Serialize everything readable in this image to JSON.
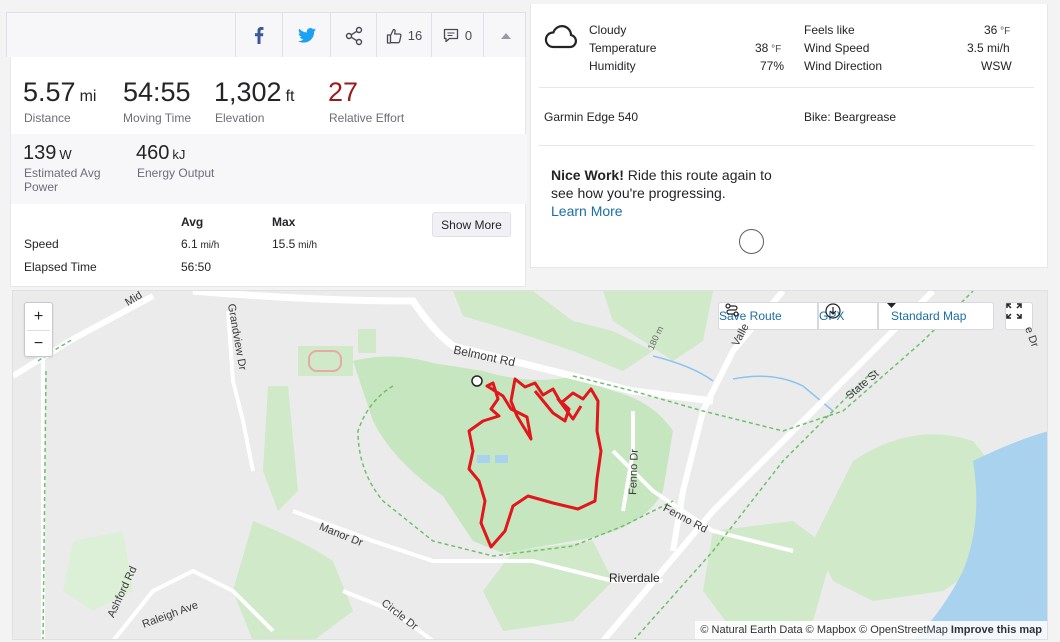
{
  "share_bar": {
    "facebook_icon": "facebook-icon",
    "twitter_icon": "twitter-icon",
    "share_icon": "share-icon",
    "kudos_count": "16",
    "comments_count": "0",
    "collapse_icon": "chevron-up-icon"
  },
  "stats": {
    "distance": {
      "value": "5.57",
      "unit": "mi",
      "label": "Distance"
    },
    "moving_time": {
      "value": "54:55",
      "label": "Moving Time"
    },
    "elevation": {
      "value": "1,302",
      "unit": "ft",
      "label": "Elevation"
    },
    "relative_effort": {
      "value": "27",
      "label": "Relative Effort",
      "color": "#9b1b1b"
    },
    "power": {
      "value": "139",
      "unit": "W",
      "label_line1": "Estimated Avg",
      "label_line2": "Power"
    },
    "energy": {
      "value": "460",
      "unit": "kJ",
      "label": "Energy Output"
    },
    "table": {
      "col_avg": "Avg",
      "col_max": "Max",
      "speed_label": "Speed",
      "speed_avg": "6.1",
      "speed_avg_unit": " mi/h",
      "speed_max": "15.5",
      "speed_max_unit": " mi/h",
      "elapsed_label": "Elapsed Time",
      "elapsed_value": "56:50"
    },
    "show_more": "Show More"
  },
  "weather": {
    "icon": "cloud-icon",
    "condition": "Cloudy",
    "temperature_label": "Temperature",
    "temperature_value": "38",
    "temperature_unit": " °F",
    "humidity_label": "Humidity",
    "humidity_value": "77%",
    "feels_like_label": "Feels like",
    "feels_like_value": "36",
    "feels_like_unit": " °F",
    "wind_speed_label": "Wind Speed",
    "wind_speed_value": "3.5 mi/h",
    "wind_direction_label": "Wind Direction",
    "wind_direction_value": "WSW"
  },
  "gear": {
    "device": "Garmin Edge 540",
    "bike": "Bike: Beargrease"
  },
  "nice_work": {
    "bold": "Nice Work!",
    "text": " Ride this route again to see how you're progressing.",
    "link": "Learn More"
  },
  "map": {
    "zoom_in": "+",
    "zoom_out": "−",
    "save_route": "Save Route",
    "gpx": "GPX",
    "map_type": "Standard Map",
    "expand_icon": "expand-icon",
    "labels": {
      "belmont": "Belmont Rd",
      "grandview": "Grandview Dr",
      "manor": "Manor Dr",
      "fenno_dr": "Fenno Dr",
      "fenno_rd": "Fenno Rd",
      "riverdale": "Riverdale",
      "state_st": "State St",
      "ashford": "Ashford Rd",
      "raleigh": "Raleigh Ave",
      "circle": "Circle Dr",
      "valley": "Valle",
      "middle": "Mid",
      "elev": "180 m",
      "edge_right": "e Dr"
    },
    "attribution": {
      "natural_earth": "© Natural Earth Data",
      "mapbox": "© Mapbox",
      "osm": "© OpenStreetMap",
      "improve": "Improve this map"
    }
  }
}
